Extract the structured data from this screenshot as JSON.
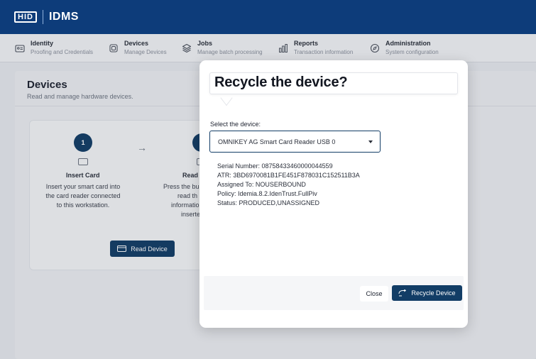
{
  "header": {
    "logo_text": "HID",
    "app_title": "IDMS"
  },
  "nav": {
    "items": [
      {
        "title": "Identity",
        "subtitle": "Proofing and Credentials",
        "icon": "id-card-icon"
      },
      {
        "title": "Devices",
        "subtitle": "Manage Devices",
        "icon": "chip-icon"
      },
      {
        "title": "Jobs",
        "subtitle": "Manage batch processing",
        "icon": "layers-icon"
      },
      {
        "title": "Reports",
        "subtitle": "Transaction information",
        "icon": "bar-chart-icon"
      },
      {
        "title": "Administration",
        "subtitle": "System configuration",
        "icon": "compass-icon"
      }
    ]
  },
  "page": {
    "title": "Devices",
    "subtitle": "Read and manage hardware devices."
  },
  "steps": [
    {
      "number": "1",
      "title": "Insert Card",
      "description_lines": [
        "Insert your smart card into",
        "the card reader connected",
        "to this workstation."
      ]
    },
    {
      "title_partial": "Read",
      "description_lines": [
        "Press the bu",
        "read th",
        "informatio",
        "inserte"
      ]
    }
  ],
  "read_button": {
    "label": "Read Device"
  },
  "modal": {
    "title": "Recycle the device?",
    "select_label": "Select the device:",
    "selected_device": "OMNIKEY AG Smart Card Reader USB 0",
    "info_lines": [
      "Serial Number: 08758433460000044559",
      "ATR: 3BD6970081B1FE451F878031C152511B3A",
      "Assigned To: NOUSERBOUND",
      "Policy: Idemia.8.2.IdenTrust.FullPiv",
      "Status: PRODUCED,UNASSIGNED"
    ],
    "close_label": "Close",
    "recycle_label": "Recycle Device"
  },
  "colors": {
    "brand": "#0d3c7a",
    "primary_button": "#123d66"
  }
}
